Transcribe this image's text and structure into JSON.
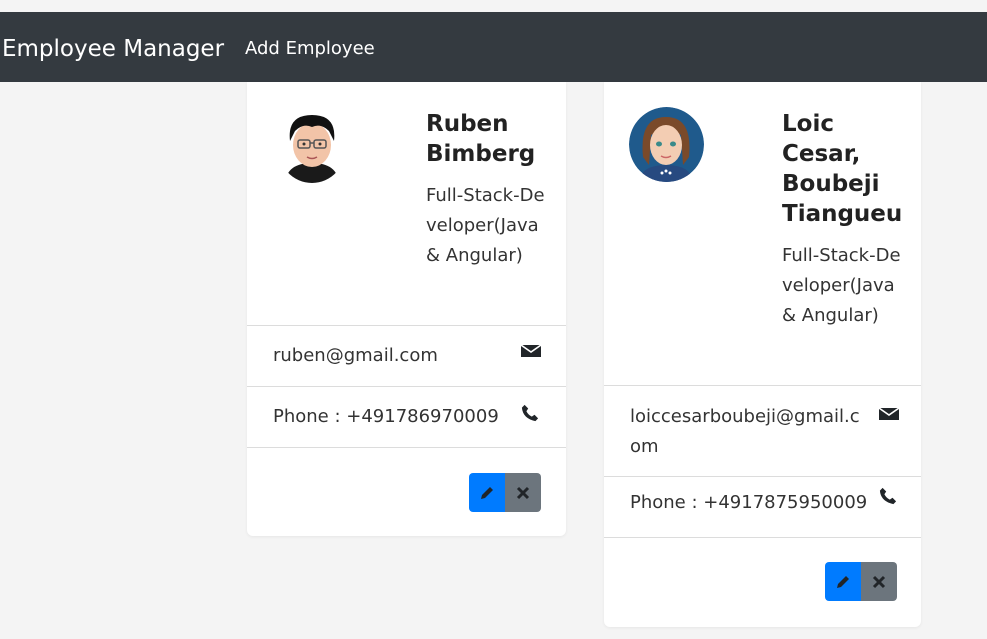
{
  "navbar": {
    "brand": "Employee Manager",
    "add_link": "Add Employee"
  },
  "employees": [
    {
      "name": "Ruben Bimberg",
      "job_title": "Full-Stack-Developer(Java & Angular)",
      "email": "ruben@gmail.com",
      "phone": "Phone : +491786970009",
      "avatar_icon": "male-cartoon-avatar"
    },
    {
      "name": "Loic Cesar, Boubeji Tiangueu",
      "job_title": "Full-Stack-Developer(Java & Angular)",
      "email": "loiccesarboubeji@gmail.com",
      "phone": "Phone : +4917875950009",
      "avatar_icon": "female-cartoon-avatar"
    }
  ],
  "colors": {
    "navbar": "#343a40",
    "edit_button": "#007bff",
    "delete_button": "#6c757d",
    "background": "#f4f4f4"
  },
  "icons": {
    "email": "envelope-icon",
    "phone": "phone-icon",
    "edit": "pencil-icon",
    "delete": "times-icon"
  }
}
